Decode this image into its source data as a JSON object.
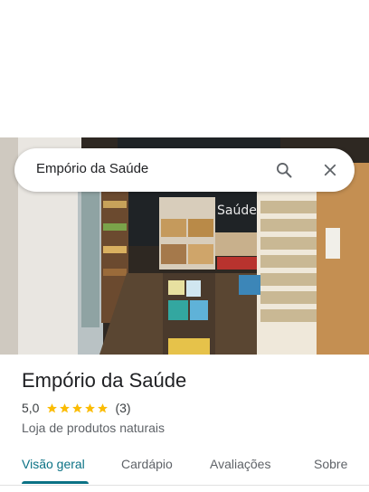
{
  "search": {
    "query": "Empório da Saúde"
  },
  "hero": {
    "alt_description": ""
  },
  "place": {
    "name": "Empório da Saúde",
    "rating": "5,0",
    "rating_value": 5,
    "review_count": "(3)",
    "category": "Loja de produtos naturais"
  },
  "tabs": [
    {
      "label": "Visão geral",
      "active": true
    },
    {
      "label": "Cardápio",
      "active": false
    },
    {
      "label": "Avaliações",
      "active": false
    },
    {
      "label": "Sobre",
      "active": false
    }
  ],
  "colors": {
    "accent": "#0b7285",
    "star": "#fbbc04",
    "text_primary": "#202124",
    "text_secondary": "#5f6368"
  },
  "icons": {
    "search": "search-icon",
    "close": "close-icon",
    "star": "star-icon"
  }
}
